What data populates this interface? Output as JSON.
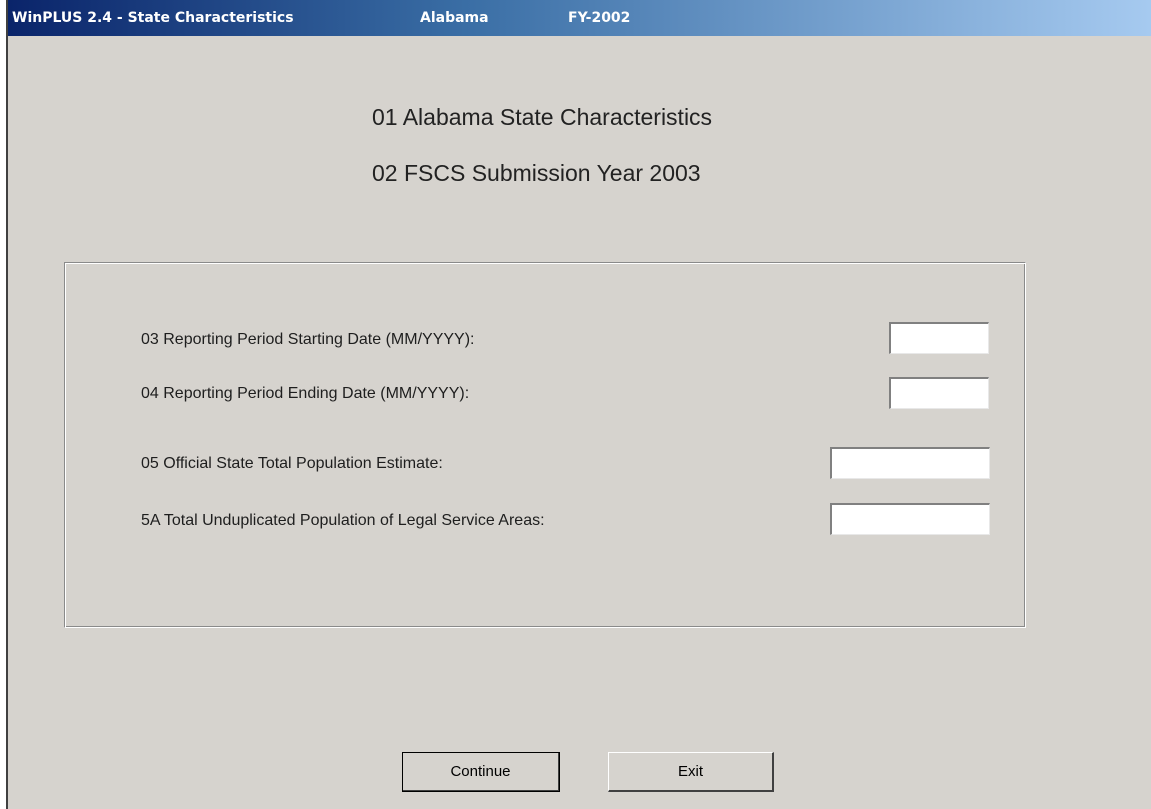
{
  "window": {
    "title_app": "WinPLUS 2.4 - State Characteristics",
    "title_state": "Alabama",
    "title_fy": "FY-2002"
  },
  "headings": {
    "line1": "01  Alabama State Characteristics",
    "line2": "02  FSCS Submission Year 2003"
  },
  "fields": [
    {
      "label": "03  Reporting Period Starting Date (MM/YYYY):",
      "value": ""
    },
    {
      "label": "04  Reporting Period Ending Date (MM/YYYY):",
      "value": ""
    },
    {
      "label": "05  Official State Total Population Estimate:",
      "value": ""
    },
    {
      "label": "5A  Total Unduplicated Population of Legal Service Areas:",
      "value": ""
    }
  ],
  "buttons": {
    "continue": "Continue",
    "exit": "Exit"
  },
  "colors": {
    "window_bg": "#d6d3ce",
    "titlebar_start": "#0a246a",
    "titlebar_end": "#a6caf0"
  }
}
